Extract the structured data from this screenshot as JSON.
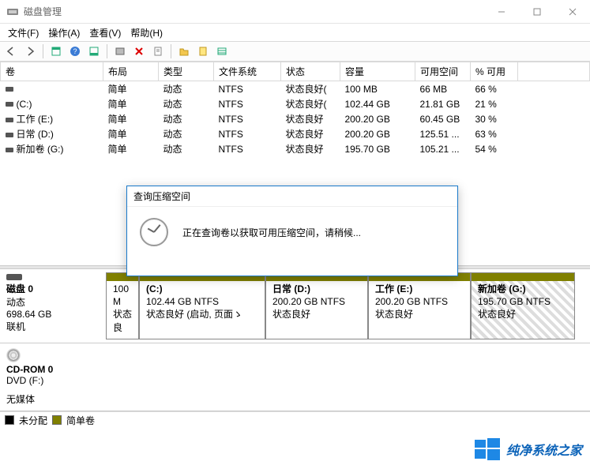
{
  "titlebar": {
    "title": "磁盘管理"
  },
  "menu": {
    "file": "文件(F)",
    "action": "操作(A)",
    "view": "查看(V)",
    "help": "帮助(H)"
  },
  "columns": {
    "volume": "卷",
    "layout": "布局",
    "type": "类型",
    "filesystem": "文件系统",
    "status": "状态",
    "capacity": "容量",
    "free": "可用空间",
    "pct": "% 可用"
  },
  "volumes": [
    {
      "name": "",
      "layout": "简单",
      "type": "动态",
      "fs": "NTFS",
      "status": "状态良好(",
      "capacity": "100 MB",
      "free": "66 MB",
      "pct": "66 %"
    },
    {
      "name": "(C:)",
      "layout": "简单",
      "type": "动态",
      "fs": "NTFS",
      "status": "状态良好(",
      "capacity": "102.44 GB",
      "free": "21.81 GB",
      "pct": "21 %"
    },
    {
      "name": "工作 (E:)",
      "layout": "简单",
      "type": "动态",
      "fs": "NTFS",
      "status": "状态良好",
      "capacity": "200.20 GB",
      "free": "60.45 GB",
      "pct": "30 %"
    },
    {
      "name": "日常 (D:)",
      "layout": "简单",
      "type": "动态",
      "fs": "NTFS",
      "status": "状态良好",
      "capacity": "200.20 GB",
      "free": "125.51 ...",
      "pct": "63 %"
    },
    {
      "name": "新加卷 (G:)",
      "layout": "简单",
      "type": "动态",
      "fs": "NTFS",
      "status": "状态良好",
      "capacity": "195.70 GB",
      "free": "105.21 ...",
      "pct": "54 %"
    }
  ],
  "disk0": {
    "header": "磁盘 0",
    "type": "动态",
    "size": "698.64 GB",
    "state": "联机",
    "parts": [
      {
        "name": "",
        "size": "100 M",
        "status": "状态良"
      },
      {
        "name": "(C:)",
        "size": "102.44 GB NTFS",
        "status": "状态良好 (启动, 页面ゝ"
      },
      {
        "name": "日常  (D:)",
        "size": "200.20 GB NTFS",
        "status": "状态良好"
      },
      {
        "name": "工作  (E:)",
        "size": "200.20 GB NTFS",
        "status": "状态良好"
      },
      {
        "name": "新加卷  (G:)",
        "size": "195.70 GB NTFS",
        "status": "状态良好"
      }
    ]
  },
  "cdrom": {
    "header": "CD-ROM 0",
    "sub": "DVD (F:)",
    "state": "无媒体"
  },
  "legend": {
    "unalloc": "未分配",
    "simple": "简单卷"
  },
  "dialog": {
    "title": "查询压缩空间",
    "message": "正在查询卷以获取可用压缩空间，请稍候..."
  },
  "watermark": "纯净系统之家"
}
